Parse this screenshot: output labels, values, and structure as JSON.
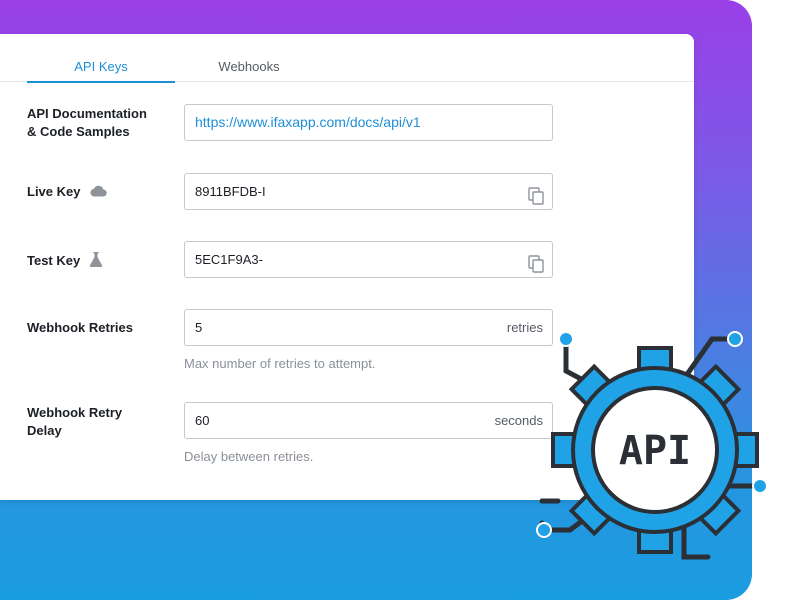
{
  "tabs": [
    {
      "label": "API Keys",
      "active": true
    },
    {
      "label": "Webhooks",
      "active": false
    }
  ],
  "fields": {
    "docs": {
      "label_line1": "API Documentation",
      "label_line2": "& Code Samples",
      "value": "https://www.ifaxapp.com/docs/api/v1"
    },
    "live_key": {
      "label": "Live Key",
      "icon": "cloud-icon",
      "value": "8911BFDB-I",
      "action_icon": "copy-icon"
    },
    "test_key": {
      "label": "Test Key",
      "icon": "flask-icon",
      "value": "5EC1F9A3-",
      "action_icon": "copy-icon"
    },
    "retries": {
      "label": "Webhook Retries",
      "value": "5",
      "suffix": "retries",
      "hint": "Max number of retries to attempt."
    },
    "retry_delay": {
      "label_line1": "Webhook Retry",
      "label_line2": "Delay",
      "value": "60",
      "suffix": "seconds",
      "hint": "Delay between retries."
    }
  },
  "illustration": {
    "text": "API",
    "icon": "api-gear-icon"
  },
  "colors": {
    "accent": "#1f8fd6",
    "gradient_top": "#9a3fe8",
    "gradient_bottom": "#1a9ce0",
    "gear_blue": "#1fa3e6",
    "gear_dark": "#2b2f36"
  }
}
